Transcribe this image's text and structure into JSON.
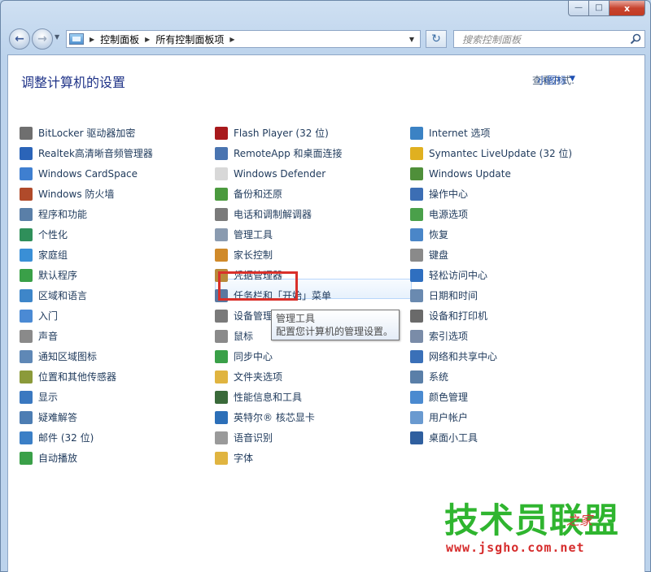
{
  "window": {
    "caption_buttons": [
      "minimize",
      "maximize",
      "close"
    ],
    "close_glyph": "x"
  },
  "nav": {
    "breadcrumb": [
      "控制面板",
      "所有控制面板项"
    ],
    "search_placeholder": "搜索控制面板"
  },
  "header": {
    "title": "调整计算机的设置",
    "view_by_label": "查看方式:",
    "view_by_value": "小图标"
  },
  "columns": {
    "col1": [
      {
        "label": "BitLocker 驱动器加密",
        "icon": "bitlocker-icon",
        "color": "#6f6f6f"
      },
      {
        "label": "Realtek高清晰音频管理器",
        "icon": "realtek-audio-icon",
        "color": "#2b64b8"
      },
      {
        "label": "Windows CardSpace",
        "icon": "cardspace-icon",
        "color": "#3f7fd0"
      },
      {
        "label": "Windows 防火墙",
        "icon": "firewall-icon",
        "color": "#b04a2a"
      },
      {
        "label": "程序和功能",
        "icon": "programs-icon",
        "color": "#5a7fa8"
      },
      {
        "label": "个性化",
        "icon": "personalization-icon",
        "color": "#2f8f5a"
      },
      {
        "label": "家庭组",
        "icon": "homegroup-icon",
        "color": "#3a8fd6"
      },
      {
        "label": "默认程序",
        "icon": "default-programs-icon",
        "color": "#3aa048"
      },
      {
        "label": "区域和语言",
        "icon": "region-language-icon",
        "color": "#3e86c9"
      },
      {
        "label": "入门",
        "icon": "getting-started-icon",
        "color": "#4b8ad4"
      },
      {
        "label": "声音",
        "icon": "sound-icon",
        "color": "#8a8a8a"
      },
      {
        "label": "通知区域图标",
        "icon": "notification-icons-icon",
        "color": "#5f88b6"
      },
      {
        "label": "位置和其他传感器",
        "icon": "location-sensors-icon",
        "color": "#8b9a3a"
      },
      {
        "label": "显示",
        "icon": "display-icon",
        "color": "#3a78c0"
      },
      {
        "label": "疑难解答",
        "icon": "troubleshooting-icon",
        "color": "#4d7db3"
      },
      {
        "label": "邮件 (32 位)",
        "icon": "mail-icon",
        "color": "#3b7fc6"
      },
      {
        "label": "自动播放",
        "icon": "autoplay-icon",
        "color": "#3aa048"
      }
    ],
    "col2": [
      {
        "label": "Flash Player (32 位)",
        "icon": "flash-player-icon",
        "color": "#a8191c"
      },
      {
        "label": "RemoteApp 和桌面连接",
        "icon": "remoteapp-icon",
        "color": "#4a74b0"
      },
      {
        "label": "Windows Defender",
        "icon": "defender-icon",
        "color": "#d8d8d8"
      },
      {
        "label": "备份和还原",
        "icon": "backup-restore-icon",
        "color": "#4b9a3e"
      },
      {
        "label": "电话和调制解调器",
        "icon": "phone-modem-icon",
        "color": "#7a7a7a"
      },
      {
        "label": "管理工具",
        "icon": "admin-tools-icon",
        "color": "#8a9bb0"
      },
      {
        "label": "家长控制",
        "icon": "parental-controls-icon",
        "color": "#d08a2a"
      },
      {
        "label": "凭据管理器",
        "icon": "credential-manager-icon",
        "color": "#b88a3a"
      },
      {
        "label": "任务栏和「开始」菜单",
        "icon": "taskbar-icon",
        "color": "#5a78a0"
      },
      {
        "label": "设备管理器",
        "icon": "device-manager-icon",
        "color": "#7a7a7a"
      },
      {
        "label": "鼠标",
        "icon": "mouse-icon",
        "color": "#8a8a8a"
      },
      {
        "label": "同步中心",
        "icon": "sync-center-icon",
        "color": "#3aa048"
      },
      {
        "label": "文件夹选项",
        "icon": "folder-options-icon",
        "color": "#e0b440"
      },
      {
        "label": "性能信息和工具",
        "icon": "performance-icon",
        "color": "#3a6a3a"
      },
      {
        "label": "英特尔® 核芯显卡",
        "icon": "intel-graphics-icon",
        "color": "#2c6fb8"
      },
      {
        "label": "语音识别",
        "icon": "speech-icon",
        "color": "#9a9a9a"
      },
      {
        "label": "字体",
        "icon": "fonts-icon",
        "color": "#e0b440"
      }
    ],
    "col3": [
      {
        "label": "Internet 选项",
        "icon": "internet-options-icon",
        "color": "#3b82c4"
      },
      {
        "label": "Symantec LiveUpdate (32 位)",
        "icon": "liveupdate-icon",
        "color": "#e0b020"
      },
      {
        "label": "Windows Update",
        "icon": "windows-update-icon",
        "color": "#4f8f3a"
      },
      {
        "label": "操作中心",
        "icon": "action-center-icon",
        "color": "#3c6eb4"
      },
      {
        "label": "电源选项",
        "icon": "power-options-icon",
        "color": "#4aa04a"
      },
      {
        "label": "恢复",
        "icon": "recovery-icon",
        "color": "#4a86c8"
      },
      {
        "label": "键盘",
        "icon": "keyboard-icon",
        "color": "#8a8a8a"
      },
      {
        "label": "轻松访问中心",
        "icon": "ease-of-access-icon",
        "color": "#2f6fc0"
      },
      {
        "label": "日期和时间",
        "icon": "date-time-icon",
        "color": "#6a8ab0"
      },
      {
        "label": "设备和打印机",
        "icon": "devices-printers-icon",
        "color": "#6a6a6a"
      },
      {
        "label": "索引选项",
        "icon": "indexing-icon",
        "color": "#7a8ca8"
      },
      {
        "label": "网络和共享中心",
        "icon": "network-sharing-icon",
        "color": "#3a70b8"
      },
      {
        "label": "系统",
        "icon": "system-icon",
        "color": "#5a7fa8"
      },
      {
        "label": "颜色管理",
        "icon": "color-management-icon",
        "color": "#4a8ad0"
      },
      {
        "label": "用户帐户",
        "icon": "user-accounts-icon",
        "color": "#6a9ad0"
      },
      {
        "label": "桌面小工具",
        "icon": "desktop-gadgets-icon",
        "color": "#2f5f9f"
      }
    ]
  },
  "tooltip": {
    "title": "管理工具",
    "description": "配置您计算机的管理设置。"
  },
  "watermark": {
    "main": "技术员联盟",
    "side": "之家",
    "url": "www.jsgho.com.net"
  },
  "colors": {
    "highlight_border": "#d9302a",
    "watermark_green": "#2fb52f",
    "watermark_red": "#d62c2c"
  }
}
